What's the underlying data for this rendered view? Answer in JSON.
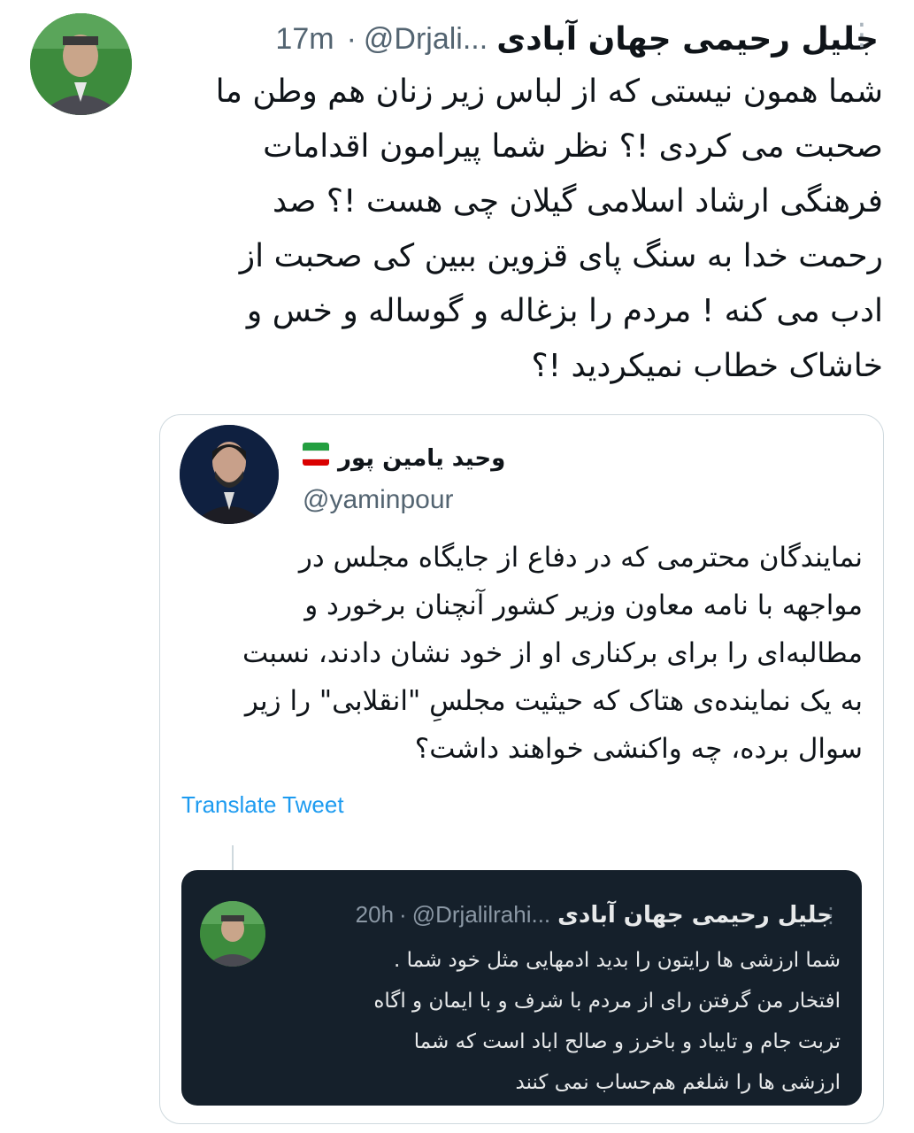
{
  "tweet": {
    "author_name": "جلیل رحیمی جهان آبادی",
    "handle": "@Drjali...",
    "separator": "·",
    "time": "17m",
    "text": "شما همون نیستی که از لباس زیر زنان هم وطن ما\nصحبت می کردی !؟ نظر شما پیرامون اقدامات\nفرهنگی ارشاد اسلامی گیلان چی هست !؟ صد\nرحمت خدا به سنگ پای قزوین ببین کی صحبت از\nادب می کنه ! مردم را بزغاله و گوساله و خس و\nخاشاک خطاب نمیکردید !؟"
  },
  "quoted": {
    "author_name": "وحید یامین پور",
    "handle": "@yaminpour",
    "text": "نمایندگان محترمی که در دفاع از جایگاه مجلس در\nمواجهه با نامه معاون وزیر کشور آنچنان برخورد و\nمطالبه‌ای را برای برکناری او از خود نشان دادند، نسبت\nبه یک نماینده‌ی هتاک که حیثیت مجلسِ \"انقلابی\" را زیر\nسوال برده، چه واکنشی خواهند داشت؟",
    "translate_label": "Translate Tweet",
    "flag_colors": [
      "#239f40",
      "#ffffff",
      "#da0000"
    ]
  },
  "reply_screenshot": {
    "author_name": "جلیل رحیمی جهان آبادی",
    "handle": "@Drjalilrahi...",
    "separator": "·",
    "time": "20h",
    "text": "شما ارزشی ها رایتون را بدید ادمهایی مثل خود شما .\nافتخار من گرفتن رای از مردم با شرف و با ایمان و اگاه\nتربت جام و تایباد و باخرز و صالح اباد است که شما\nارزشی ها را شلغم هم‌حساب نمی کنند"
  },
  "icons": {
    "more": "more-vertical-icon",
    "avatar": "avatar-image"
  },
  "colors": {
    "link": "#1d9bf0",
    "dark_bg": "#15202b",
    "secondary": "#536471"
  }
}
